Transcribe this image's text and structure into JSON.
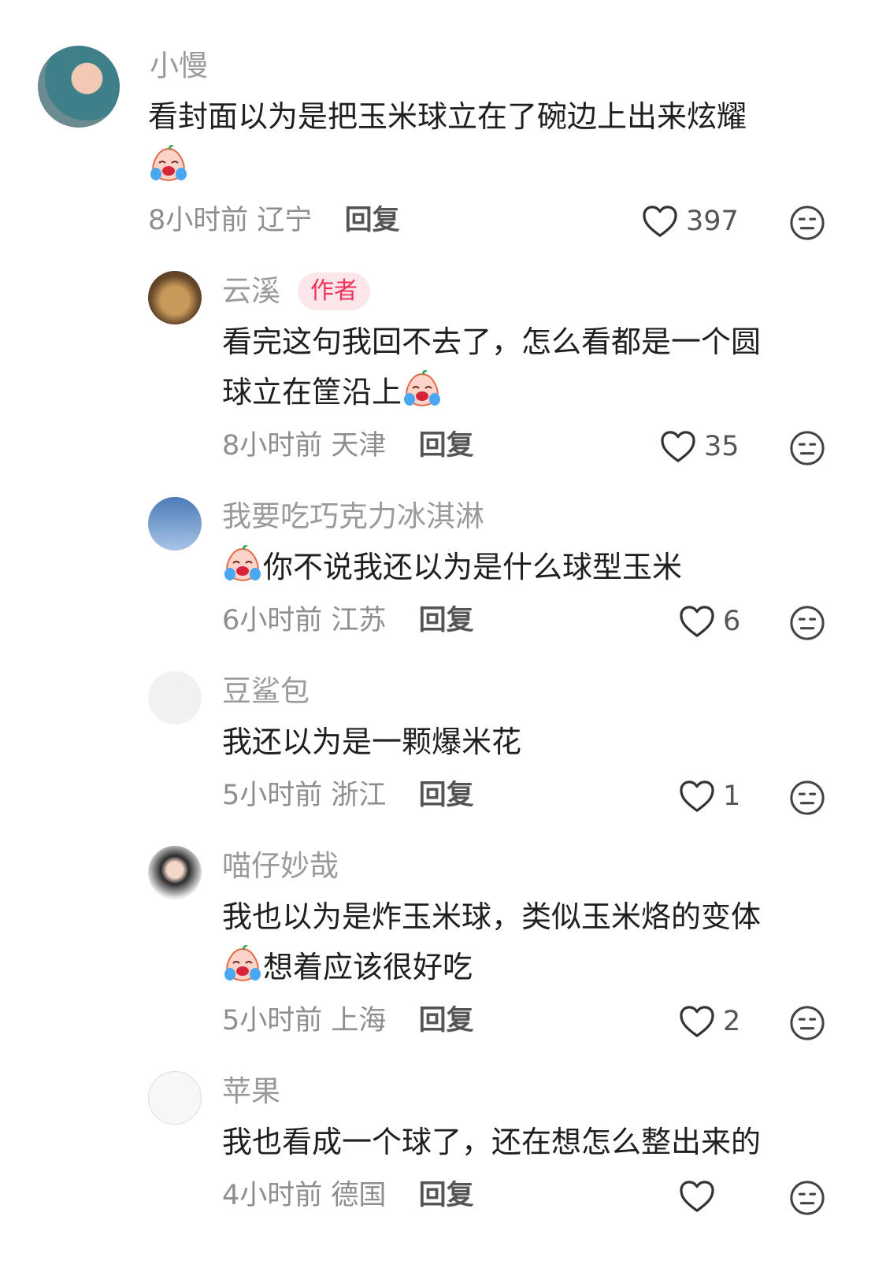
{
  "comments": [
    {
      "user": "小慢",
      "text": [
        "看封面以为是把玉米球立在了碗边上出来炫耀",
        ""
      ],
      "time": "8小时前",
      "location": "辽宁",
      "reply": "回复",
      "likes": "397"
    },
    {
      "user": "云溪",
      "badge": "作者",
      "text": [
        "看完这句我回不去了，怎么看都是一个圆",
        "球立在筐沿上"
      ],
      "time": "8小时前",
      "location": "天津",
      "reply": "回复",
      "likes": "35"
    },
    {
      "user": "我要吃巧克力冰淇淋",
      "text": [
        "你不说我还以为是什么球型玉米"
      ],
      "time": "6小时前",
      "location": "江苏",
      "reply": "回复",
      "likes": "6"
    },
    {
      "user": "豆鲨包",
      "text": [
        "我还以为是一颗爆米花"
      ],
      "time": "5小时前",
      "location": "浙江",
      "reply": "回复",
      "likes": "1"
    },
    {
      "user": "喵仔妙哉",
      "text": [
        "我也以为是炸玉米球，类似玉米烙的变体",
        "想着应该很好吃"
      ],
      "time": "5小时前",
      "location": "上海",
      "reply": "回复",
      "likes": "2"
    },
    {
      "user": "苹果",
      "text": [
        "我也看成一个球了，还在想怎么整出来的"
      ],
      "time": "4小时前",
      "location": "德国",
      "reply": "回复",
      "likes": ""
    }
  ],
  "icons": {
    "like": "heart-outline-icon",
    "dislike": "meh-face-icon",
    "emoji": "crying-face-emoji"
  }
}
